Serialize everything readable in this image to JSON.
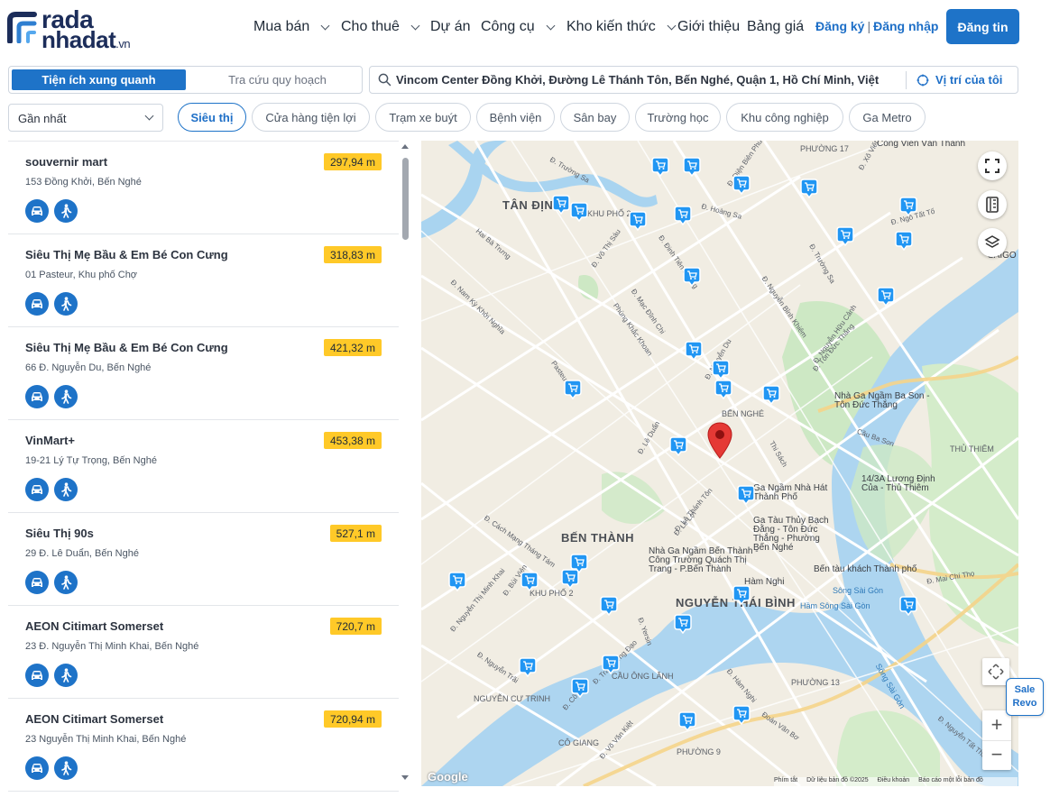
{
  "header": {
    "logo_line1": "rada",
    "logo_line2": "nhadat",
    "logo_suffix": ".vn",
    "nav": [
      {
        "label": "Mua bán",
        "dropdown": true
      },
      {
        "label": "Cho thuê",
        "dropdown": true
      },
      {
        "label": "Dự án",
        "dropdown": false
      },
      {
        "label": "Công cụ",
        "dropdown": true
      },
      {
        "label": "Kho kiến thức",
        "dropdown": true
      },
      {
        "label": "Giới thiệu",
        "dropdown": false
      },
      {
        "label": "Bảng giá",
        "dropdown": false
      }
    ],
    "register": "Đăng ký",
    "separator": "|",
    "login": "Đăng nhập",
    "post_button": "Đăng tin"
  },
  "toolbar": {
    "tab_active": "Tiện ích xung quanh",
    "tab_inactive": "Tra cứu quy hoạch",
    "search_value": "Vincom Center Đồng Khởi, Đường Lê Thánh Tôn, Bến Nghé, Quận 1, Hồ Chí Minh, Việt",
    "my_location": "Vị trí của tôi",
    "sort_value": "Gần nhất",
    "categories": [
      {
        "label": "Siêu thị",
        "active": true
      },
      {
        "label": "Cửa hàng tiện lợi",
        "active": false
      },
      {
        "label": "Trạm xe buýt",
        "active": false
      },
      {
        "label": "Bệnh viện",
        "active": false
      },
      {
        "label": "Sân bay",
        "active": false
      },
      {
        "label": "Trường học",
        "active": false
      },
      {
        "label": "Khu công nghiệp",
        "active": false
      },
      {
        "label": "Ga Metro",
        "active": false
      }
    ]
  },
  "results": [
    {
      "name": "souvernir mart",
      "address": "153 Đồng Khởi, Bến Nghé",
      "distance": "297,94 m"
    },
    {
      "name": "Siêu Thị Mẹ Bầu & Em Bé Con Cưng",
      "address": "01 Pasteur, Khu phố Chợ",
      "distance": "318,83 m"
    },
    {
      "name": "Siêu Thị Mẹ Bầu & Em Bé Con Cưng",
      "address": "66 Đ. Nguyễn Du, Bến Nghé",
      "distance": "421,32 m"
    },
    {
      "name": "VinMart+",
      "address": "19-21 Lý Tự Trọng, Bến Nghé",
      "distance": "453,38 m"
    },
    {
      "name": "Siêu Thị 90s",
      "address": "29 Đ. Lê Duẩn, Bến Nghé",
      "distance": "527,1 m"
    },
    {
      "name": "AEON Citimart Somerset",
      "address": "23 Đ. Nguyễn Thị Minh Khai, Bến Nghé",
      "distance": "720,7 m"
    },
    {
      "name": "AEON Citimart Somerset",
      "address": "23 Nguyễn Thị Minh Khai, Bến Nghé",
      "distance": "720,94 m"
    }
  ],
  "map": {
    "labels_big": [
      "TÂN ĐỊNH",
      "BẾN THÀNH",
      "NGUYỄN THÁI BÌNH"
    ],
    "labels_area": [
      "KHU PHỐ 2",
      "KHU PHỐ 2",
      "BẾN NGHÉ",
      "CẦU ÔNG LÃNH",
      "THỦ THIÊM",
      "PHƯỜNG 13",
      "PHƯỜNG 9",
      "CÔ GIANG",
      "PHƯỜNG 17",
      "NGUYỄN CƯ TRINH"
    ],
    "labels_poi": [
      "Nhà Ga Ngầm Ba Son - Tôn Đức Thắng",
      "Ga Ngầm Nhà Hát Thành Phố",
      "Ga Tàu Thủy Bạch Đằng - Tôn Đức Thắng - Phường Bến Nghé",
      "Nhà Ga Ngầm Bến Thành - Công Trường Quách Thị Trang - P.Bến Thành",
      "Bến tàu khách Thành phố",
      "14/3A Lương Định Của - Thủ Thiêm",
      "Hàm Nghi",
      "Sông Sài Gòn",
      "Hầm Sông Sài Gòn",
      "Sông Sài Gòn",
      "Công Viên Văn Thánh",
      "SAIGO"
    ],
    "labels_road": [
      "Đ. Trường Sa",
      "Đ. Hoàng Sa",
      "Đ. Điện Biên Phủ",
      "Hai Bà Trưng",
      "Đ. Nam Kỳ Khởi Nghĩa",
      "Đ. Võ Thị Sáu",
      "Đ. Đinh Tiên Hoàng",
      "Phùng Khắc Khoan",
      "Đ. Mạc Đĩnh Chi",
      "Pasteur",
      "Đ. Nguyễn Du",
      "Đ. Lê Duẩn",
      "Đ. Lê Thánh Tôn",
      "Đ. Lê Lợi",
      "Đ. Cách Mạng Tháng Tám",
      "Đ. Nguyễn Thị Minh Khai",
      "Đ. Bùi Viện",
      "Đ. Nguyễn Trãi",
      "Đ. Trần Hưng Đạo",
      "Đ. Võ Văn Kiệt",
      "Đ. Nguyễn Hữu Cảnh",
      "Đ. Mai Chí Thọ",
      "Cầu Ba Son",
      "Đ. Tôn Đức Thắng",
      "Thi Sách",
      "Đ. Hàm Nghi",
      "Đ. Nguyễn Bỉnh Khiêm",
      "Đ. Trường Sa",
      "Đ. Nguyễn Tất Thành",
      "Đ. Xô Viết",
      "Đ. Ngô Tất Tố",
      "Đoàn Văn Bơ",
      "Đ. Cô Bắc",
      "Đ. Yersin"
    ],
    "attribution": [
      "Phím tắt",
      "Dữ liệu bản đồ ©2025",
      "Điều khoản",
      "Báo cáo một lỗi bản đồ"
    ],
    "google": "Google"
  },
  "sale_badge": {
    "line1": "Sale",
    "line2": "Revo"
  },
  "colors": {
    "primary": "#1e73c8",
    "distance_badge": "#ffc928",
    "main_pin": "#e53935"
  },
  "icons": {
    "car": "car-icon",
    "walk": "walk-icon",
    "search": "search-icon",
    "location": "location-icon"
  }
}
